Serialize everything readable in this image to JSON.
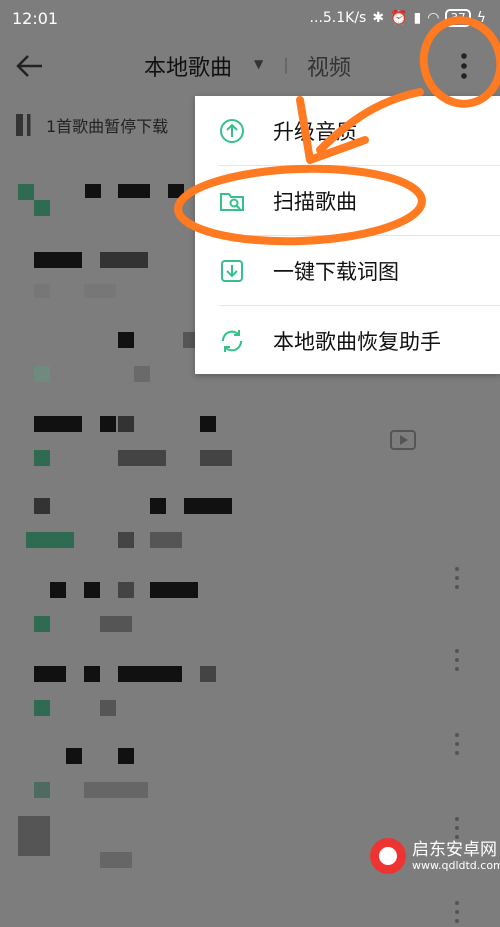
{
  "status": {
    "time": "12:01",
    "net_speed": "...5.1K/s",
    "battery": "37"
  },
  "topbar": {
    "title": "本地歌曲",
    "tab_video": "视频"
  },
  "banner": {
    "text": "1首歌曲暂停下载"
  },
  "menu": {
    "items": [
      {
        "label": "升级音质",
        "icon": "upgrade-quality-icon"
      },
      {
        "label": "扫描歌曲",
        "icon": "scan-folder-icon"
      },
      {
        "label": "一键下载词图",
        "icon": "download-icon"
      },
      {
        "label": "本地歌曲恢复助手",
        "icon": "restore-icon"
      }
    ]
  },
  "watermark": {
    "name": "启东安卓网",
    "url": "www.qdldtd.com"
  },
  "colors": {
    "accent": "#34c28a",
    "annotation": "#ff7a20",
    "dim_overlay": "#7d7d7d"
  }
}
